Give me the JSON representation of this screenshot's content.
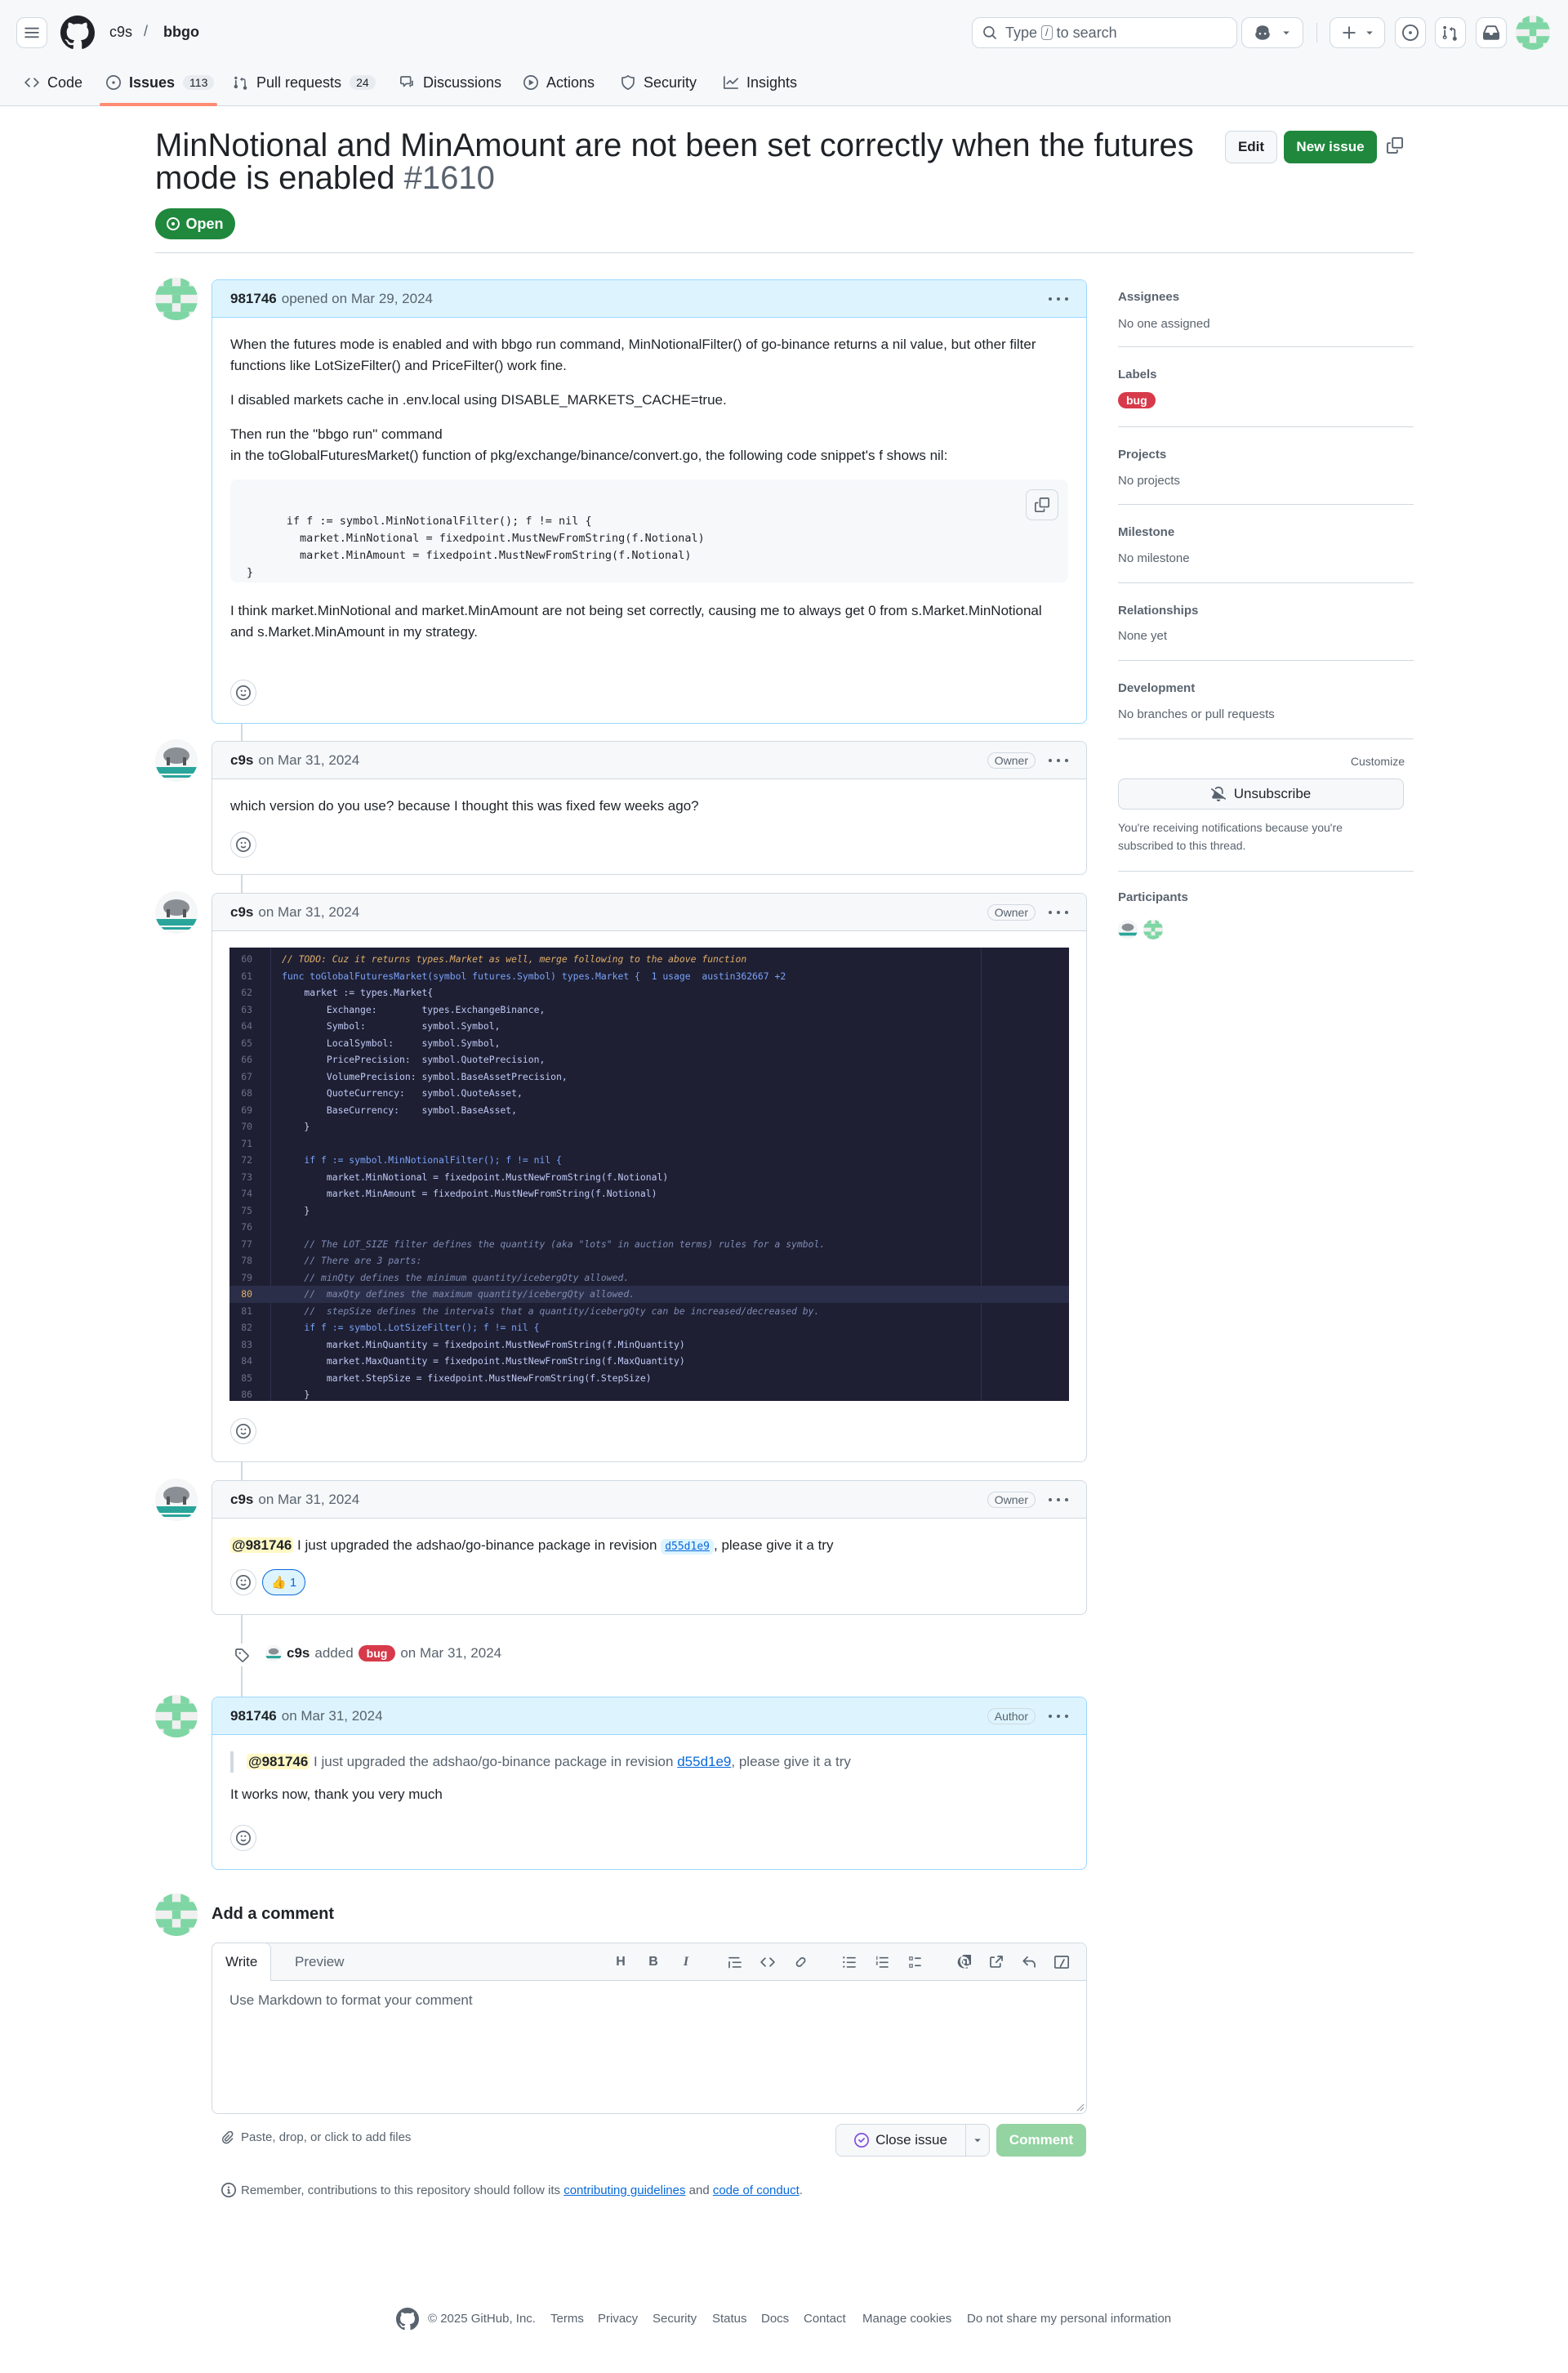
{
  "header": {
    "owner": "c9s",
    "separator": "/",
    "repo": "bbgo",
    "search_prefix": "Type",
    "search_key": "/",
    "search_suffix": "to search"
  },
  "repo_tabs": [
    {
      "label": "Code"
    },
    {
      "label": "Issues",
      "count": "113"
    },
    {
      "label": "Pull requests",
      "count": "24"
    },
    {
      "label": "Discussions"
    },
    {
      "label": "Actions"
    },
    {
      "label": "Security"
    },
    {
      "label": "Insights"
    }
  ],
  "issue": {
    "title": "MinNotional and MinAmount are not been set correctly when the futures mode is enabled",
    "number": "#1610",
    "state": "Open",
    "edit_label": "Edit",
    "new_issue_label": "New issue"
  },
  "comments": [
    {
      "author": "981746",
      "meta": "opened on Mar 29, 2024",
      "p1": "When the futures mode is enabled and with bbgo run command, MinNotionalFilter() of go-binance returns a nil value, but other filter functions like LotSizeFilter() and PriceFilter() work fine.",
      "p2": "I disabled markets cache in .env.local using DISABLE_MARKETS_CACHE=true.",
      "p3a": "Then run the \"bbgo run\" command",
      "p3b": "in the toGlobalFuturesMarket() function of pkg/exchange/binance/convert.go, the following code snippet's f shows nil:",
      "code": "if f := symbol.MinNotionalFilter(); f != nil {\n        market.MinNotional = fixedpoint.MustNewFromString(f.Notional)\n        market.MinAmount = fixedpoint.MustNewFromString(f.Notional)\n}",
      "p4": "I think market.MinNotional and market.MinAmount are not being set correctly, causing me to always get 0 from s.Market.MinNotional and s.Market.MinAmount in my strategy."
    },
    {
      "author": "c9s",
      "meta": "on Mar 31, 2024",
      "role": "Owner",
      "body": "which version do you use? because I thought this was fixed few weeks ago?"
    },
    {
      "author": "c9s",
      "meta": "on Mar 31, 2024",
      "role": "Owner"
    },
    {
      "author": "c9s",
      "meta": "on Mar 31, 2024",
      "role": "Owner",
      "mention": "@981746",
      "text_a": "I just upgraded the adshao/go-binance package in revision",
      "sha": "d55d1e9",
      "text_b": ", please give it a try",
      "reaction_emoji": "👍",
      "reaction_count": "1"
    },
    {
      "author": "981746",
      "meta": "on Mar 31, 2024",
      "role": "Author",
      "quote_mention": "@981746",
      "quote_text": "I just upgraded the adshao/go-binance package in revision",
      "quote_sha": "d55d1e9",
      "quote_tail": ", please give it a try",
      "body": "It works now, thank you very much"
    }
  ],
  "event": {
    "actor": "c9s",
    "action": "added",
    "label": "bug",
    "when": "on Mar 31, 2024"
  },
  "code_image": {
    "lines": [
      {
        "n": "60",
        "t": "// TODO: Cuz it returns types.Market as well, merge following to the above function"
      },
      {
        "n": "61",
        "t": "func toGlobalFuturesMarket(symbol futures.Symbol) types.Market {  1 usage  austin362667 +2"
      },
      {
        "n": "62",
        "t": "    market := types.Market{"
      },
      {
        "n": "63",
        "t": "        Exchange:        types.ExchangeBinance,"
      },
      {
        "n": "64",
        "t": "        Symbol:          symbol.Symbol,"
      },
      {
        "n": "65",
        "t": "        LocalSymbol:     symbol.Symbol,"
      },
      {
        "n": "66",
        "t": "        PricePrecision:  symbol.QuotePrecision,"
      },
      {
        "n": "67",
        "t": "        VolumePrecision: symbol.BaseAssetPrecision,"
      },
      {
        "n": "68",
        "t": "        QuoteCurrency:   symbol.QuoteAsset,"
      },
      {
        "n": "69",
        "t": "        BaseCurrency:    symbol.BaseAsset,"
      },
      {
        "n": "70",
        "t": "    }"
      },
      {
        "n": "71",
        "t": ""
      },
      {
        "n": "72",
        "t": "    if f := symbol.MinNotionalFilter(); f != nil {"
      },
      {
        "n": "73",
        "t": "        market.MinNotional = fixedpoint.MustNewFromString(f.Notional)"
      },
      {
        "n": "74",
        "t": "        market.MinAmount = fixedpoint.MustNewFromString(f.Notional)"
      },
      {
        "n": "75",
        "t": "    }"
      },
      {
        "n": "76",
        "t": ""
      },
      {
        "n": "77",
        "t": "    // The LOT_SIZE filter defines the quantity (aka \"lots\" in auction terms) rules for a symbol."
      },
      {
        "n": "78",
        "t": "    // There are 3 parts:"
      },
      {
        "n": "79",
        "t": "    // minQty defines the minimum quantity/icebergQty allowed."
      },
      {
        "n": "80",
        "t": "    //  maxQty defines the maximum quantity/icebergQty allowed."
      },
      {
        "n": "81",
        "t": "    //  stepSize defines the intervals that a quantity/icebergQty can be increased/decreased by."
      },
      {
        "n": "82",
        "t": "    if f := symbol.LotSizeFilter(); f != nil {"
      },
      {
        "n": "83",
        "t": "        market.MinQuantity = fixedpoint.MustNewFromString(f.MinQuantity)"
      },
      {
        "n": "84",
        "t": "        market.MaxQuantity = fixedpoint.MustNewFromString(f.MaxQuantity)"
      },
      {
        "n": "85",
        "t": "        market.StepSize = fixedpoint.MustNewFromString(f.StepSize)"
      },
      {
        "n": "86",
        "t": "    }"
      }
    ]
  },
  "sidebar": {
    "assignees_h": "Assignees",
    "assignees_v": "No one assigned",
    "labels_h": "Labels",
    "labels_v": "bug",
    "projects_h": "Projects",
    "projects_v": "No projects",
    "milestone_h": "Milestone",
    "milestone_v": "No milestone",
    "relationships_h": "Relationships",
    "relationships_v": "None yet",
    "development_h": "Development",
    "development_v": "No branches or pull requests",
    "customize": "Customize",
    "unsubscribe": "Unsubscribe",
    "notice": "You're receiving notifications because you're subscribed to this thread.",
    "participants_h": "Participants"
  },
  "form": {
    "heading": "Add a comment",
    "tab_write": "Write",
    "tab_preview": "Preview",
    "placeholder": "Use Markdown to format your comment",
    "attach": "Paste, drop, or click to add files",
    "close_issue": "Close issue",
    "comment": "Comment",
    "reminder_a": "Remember, contributions to this repository should follow its",
    "reminder_link1": "contributing guidelines",
    "reminder_and": "and",
    "reminder_link2": "code of conduct",
    "reminder_end": "."
  },
  "footer": {
    "copyright": "© 2025 GitHub, Inc.",
    "links": [
      "Terms",
      "Privacy",
      "Security",
      "Status",
      "Docs",
      "Contact",
      "Manage cookies",
      "Do not share my personal information"
    ]
  },
  "colors": {
    "accent": "#0969da",
    "open": "#1f883d",
    "bug": "#d73a4a",
    "tab_underline": "#fd8c73"
  }
}
